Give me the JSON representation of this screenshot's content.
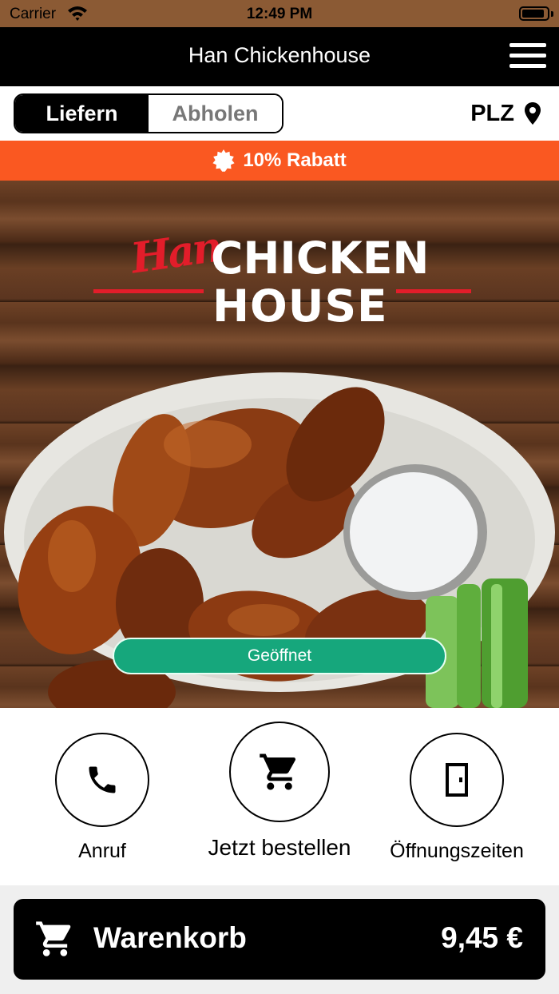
{
  "status_bar": {
    "carrier": "Carrier",
    "time": "12:49 PM",
    "battery_level": 0.9
  },
  "header": {
    "title": "Han Chickenhouse",
    "menu_icon": "hamburger-icon"
  },
  "mode_toggle": {
    "deliver_label": "Liefern",
    "pickup_label": "Abholen",
    "selected": "Liefern"
  },
  "location": {
    "label": "PLZ",
    "icon": "location-pin-icon"
  },
  "promo": {
    "text": "10% Rabatt",
    "icon": "badge-icon"
  },
  "hero": {
    "logo": {
      "script": "Han",
      "line1": "CHICKEN",
      "line2": "HOUSE"
    },
    "status": "Geöffnet"
  },
  "actions": [
    {
      "label": "Anruf",
      "icon": "phone-icon"
    },
    {
      "label": "Jetzt bestellen",
      "icon": "cart-icon"
    },
    {
      "label": "Öffnungszeiten",
      "icon": "door-icon"
    }
  ],
  "cart": {
    "label": "Warenkorb",
    "total": "9,45 €",
    "icon": "cart-icon"
  },
  "colors": {
    "header": "#000000",
    "promo": "#fa5821",
    "open_status": "#16a77c",
    "logo_red": "#e21d2a"
  }
}
